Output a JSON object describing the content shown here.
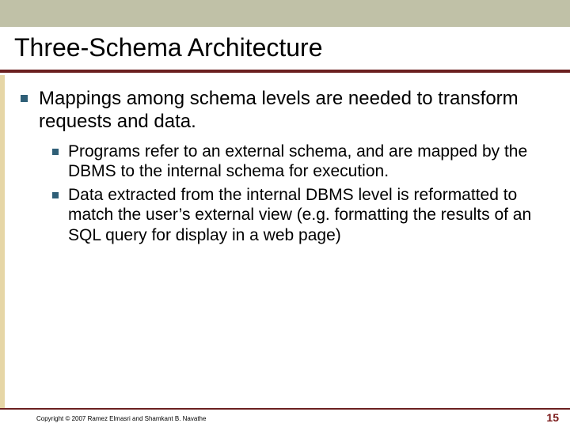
{
  "title": "Three-Schema Architecture",
  "bullets": {
    "main": "Mappings among schema levels are needed to transform requests and data.",
    "sub1": "Programs refer to an external schema, and are mapped by the DBMS to the internal schema for execution.",
    "sub2": "Data extracted from the internal DBMS level is reformatted to match the user’s external view (e.g. formatting the results of an SQL query for display in a web page)"
  },
  "footer": {
    "copyright": "Copyright © 2007 Ramez Elmasri and Shamkant B. Navathe",
    "page": "15"
  }
}
